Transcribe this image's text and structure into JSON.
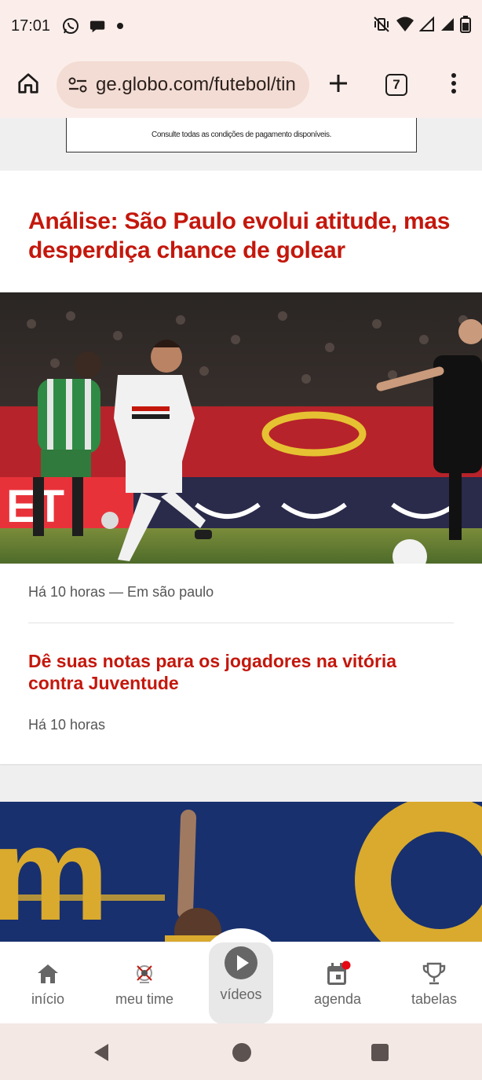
{
  "status_bar": {
    "time": "17:01",
    "left_icons": [
      "whatsapp-icon",
      "chat-bubble-icon",
      "dot-icon"
    ],
    "right_icons": [
      "mute-vibrate-icon",
      "wifi-icon",
      "signal-icon",
      "signal-icon-2",
      "battery-icon"
    ]
  },
  "browser": {
    "url": "ge.globo.com/futebol/tin",
    "tab_count": "7",
    "home_icon": "home-icon",
    "new_tab_icon": "plus-icon",
    "menu_icon": "more-vert-icon"
  },
  "ad": {
    "text": "Consulte todas as condições de pagamento disponíveis."
  },
  "article": {
    "headline": "Análise: São Paulo evolui atitude, mas desperdiça chance de golear",
    "meta": "Há 10 horas — Em são paulo",
    "related_headline": "Dê suas notas para os jogadores na vitória contra Juventude",
    "related_meta": "Há 10 horas"
  },
  "bottom_nav": {
    "items": [
      {
        "label": "início",
        "icon": "home-icon"
      },
      {
        "label": "meu time",
        "icon": "team-crest-icon"
      },
      {
        "label": "vídeos",
        "icon": "play-icon"
      },
      {
        "label": "agenda",
        "icon": "calendar-icon"
      },
      {
        "label": "tabelas",
        "icon": "trophy-icon"
      }
    ]
  },
  "colors": {
    "brand_red": "#c4170c",
    "chrome_bg": "#fbeeea",
    "urlbar_bg": "#f3dcd4"
  }
}
